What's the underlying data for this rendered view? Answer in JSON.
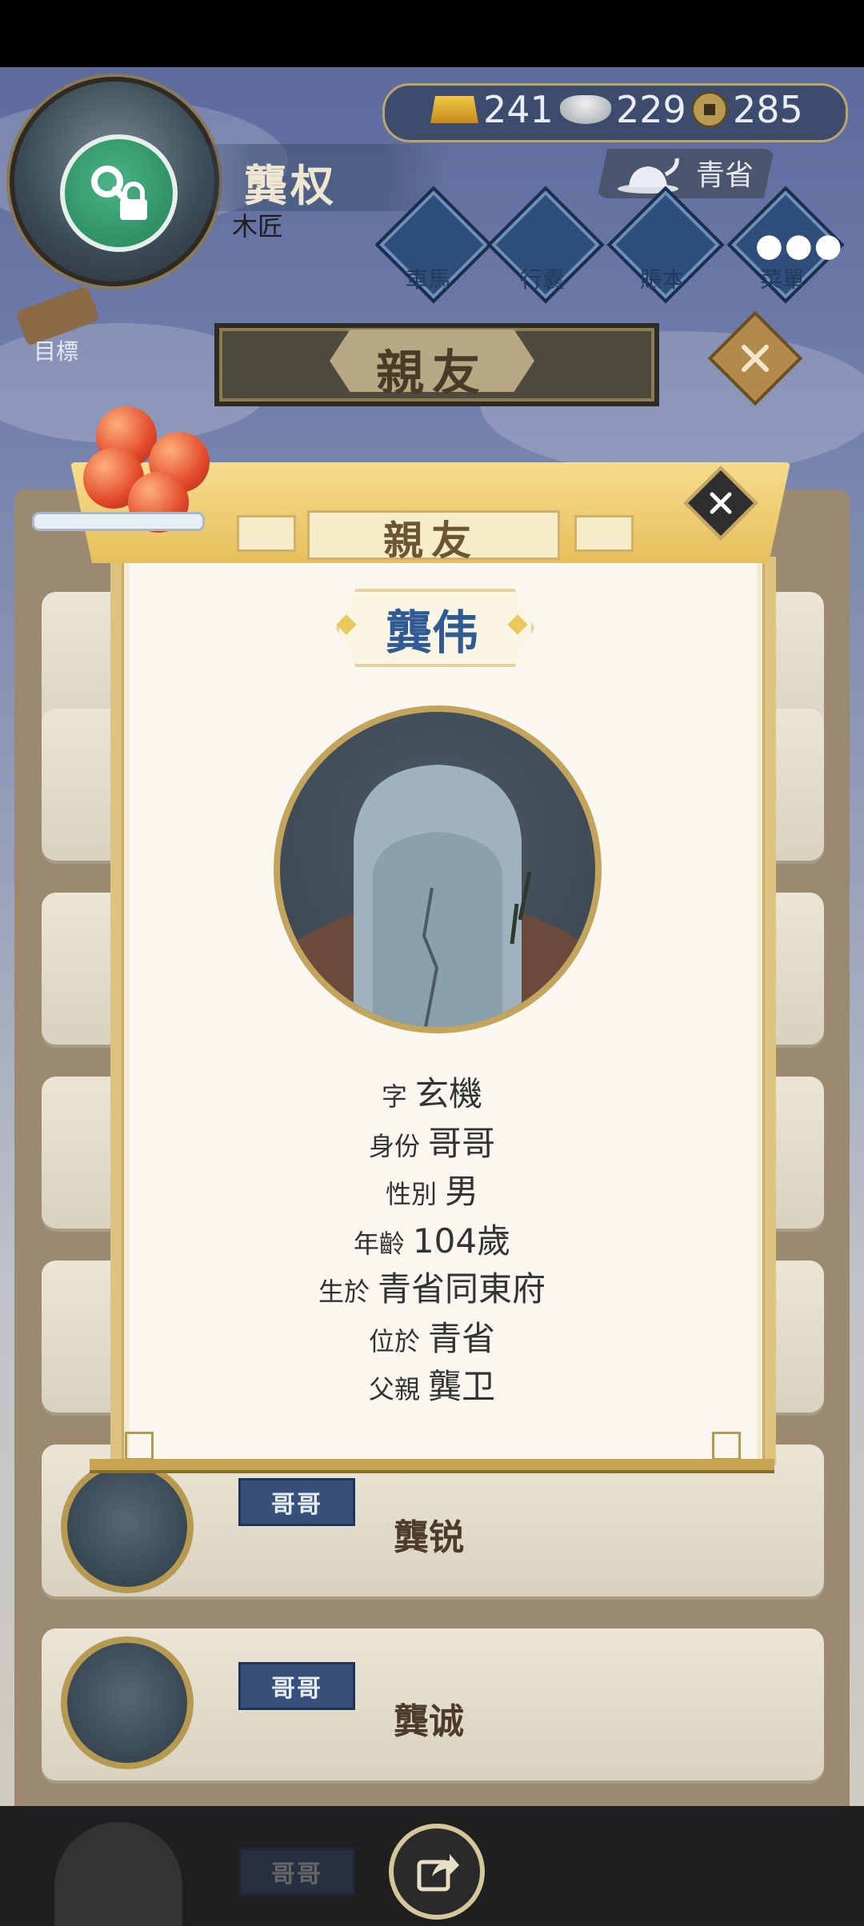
{
  "header": {
    "player_name": "龔权",
    "player_title": "木匠",
    "currency": {
      "gold": "241",
      "silver": "229",
      "coins": "285"
    },
    "region": "青省",
    "menu": [
      {
        "label": "車馬",
        "icon": "carriage-icon"
      },
      {
        "label": "行囊",
        "icon": "bundle-icon"
      },
      {
        "label": "賬本",
        "icon": "ledger-icon"
      },
      {
        "label": "菜單",
        "icon": "more-icon"
      }
    ],
    "target_label": "目標"
  },
  "page": {
    "banner_title": "親友"
  },
  "list": [
    {
      "rank": "哥哥",
      "name": "龔锐"
    },
    {
      "rank": "哥哥",
      "name": "龔诚"
    },
    {
      "rank": "哥哥",
      "name": ""
    }
  ],
  "dialog": {
    "title": "親友",
    "person_name": "龔伟",
    "fields": [
      {
        "label": "字",
        "value": "玄機"
      },
      {
        "label": "身份",
        "value": "哥哥"
      },
      {
        "label": "性別",
        "value": "男"
      },
      {
        "label": "年齡",
        "value": "104歲"
      },
      {
        "label": "生於",
        "value": "青省同東府"
      },
      {
        "label": "位於",
        "value": "青省"
      },
      {
        "label": "父親",
        "value": "龔卫"
      }
    ]
  },
  "colors": {
    "accent_gold": "#e7bf5c",
    "name_blue": "#2f5b92",
    "tag_blue": "#37507a"
  }
}
